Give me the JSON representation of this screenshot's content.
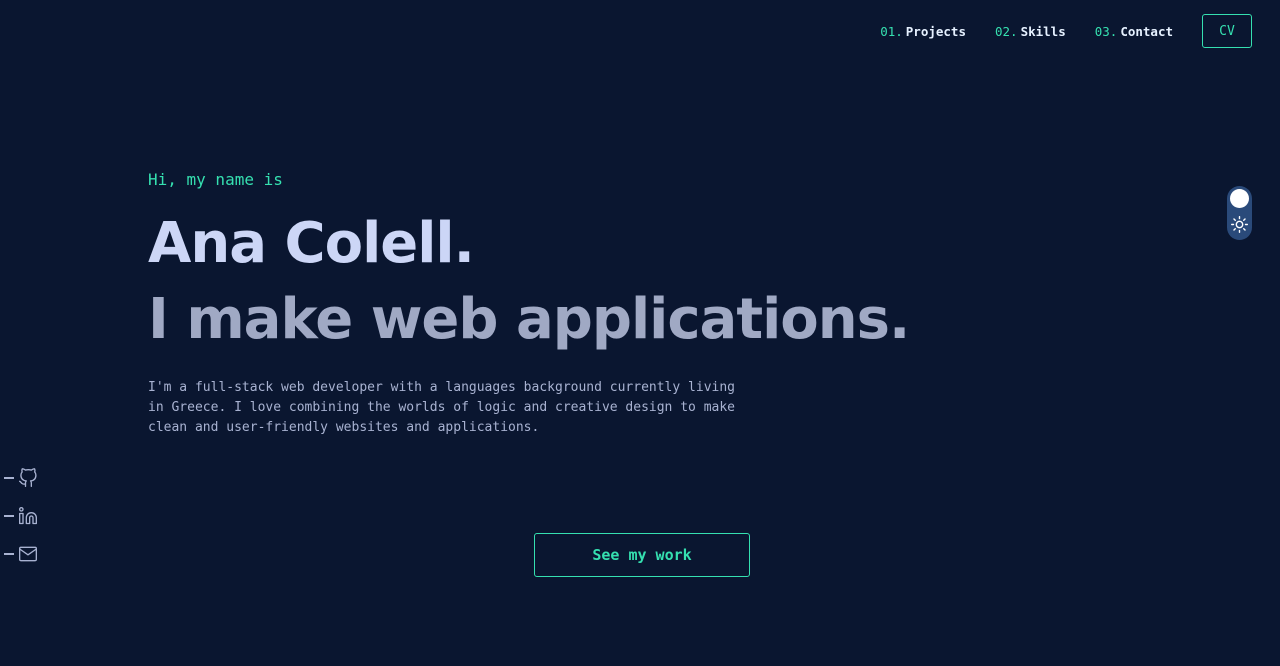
{
  "nav": {
    "items": [
      {
        "num": "01.",
        "label": "Projects"
      },
      {
        "num": "02.",
        "label": "Skills"
      },
      {
        "num": "03.",
        "label": "Contact"
      }
    ],
    "cv_label": "CV"
  },
  "hero": {
    "greeting": "Hi, my name is",
    "name": "Ana Colell.",
    "tagline": "I make web applications.",
    "bio": "I'm a full-stack web developer with a languages background currently living in Greece. I love combining the worlds of logic and creative design to make clean and user-friendly websites and applications.",
    "cta_label": "See my work"
  },
  "social": {
    "icons": [
      "github-icon",
      "linkedin-icon",
      "mail-icon"
    ]
  },
  "theme": {
    "icons": [
      "sun-icon"
    ]
  },
  "colors": {
    "background": "#0a1630",
    "accent": "#35e0b0",
    "heading": "#ccd6f6",
    "subheading": "#a0a9c4",
    "body_text": "#a8b2d1",
    "toggle_track": "#2a4a7a"
  }
}
